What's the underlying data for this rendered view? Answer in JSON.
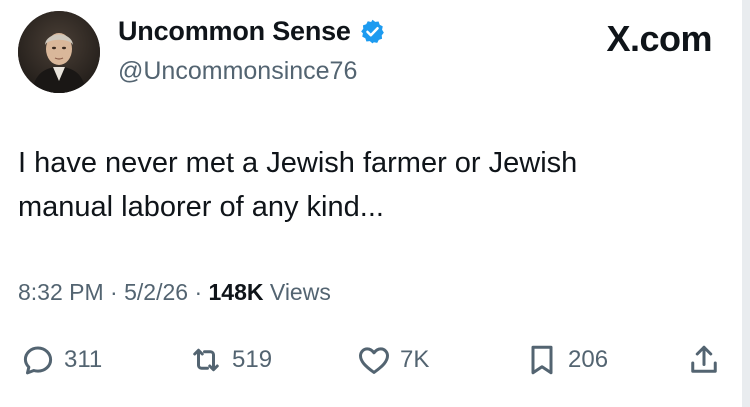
{
  "author": {
    "display_name": "Uncommon Sense",
    "handle": "@Uncommonsince76",
    "verified": true
  },
  "brand": "X.com",
  "tweet": {
    "text_line1": "I have never met a Jewish farmer or Jewish",
    "text_line2": "manual laborer of any kind...",
    "time": "8:32 PM",
    "date": "5/2/26",
    "views_count": "148K",
    "views_label": "Views"
  },
  "actions": {
    "replies": "311",
    "reposts": "519",
    "likes": "7K",
    "bookmarks": "206"
  },
  "colors": {
    "text": "#0f1419",
    "secondary": "#536471",
    "verified": "#1d9bf0"
  },
  "icons": [
    "reply-icon",
    "repost-icon",
    "like-icon",
    "bookmark-icon",
    "share-icon",
    "verified-badge-icon"
  ]
}
